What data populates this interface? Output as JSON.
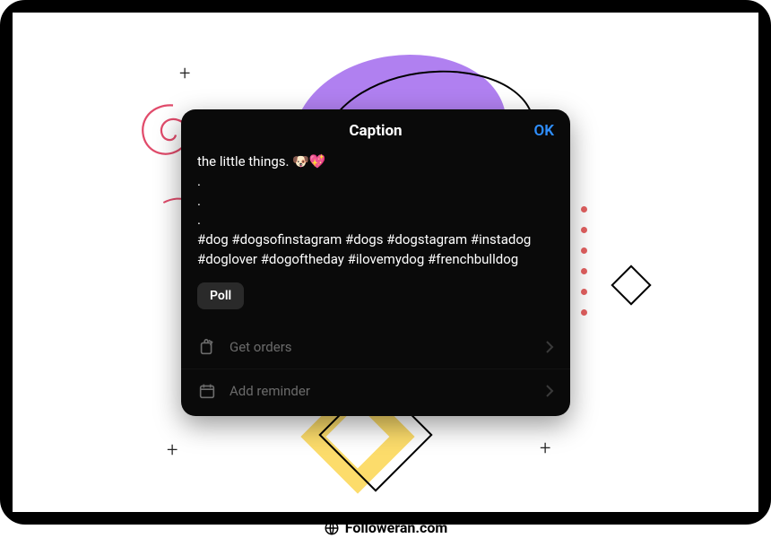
{
  "modal": {
    "title": "Caption",
    "ok_label": "OK",
    "caption_text": "the little things. 🐶💖\n.\n.\n.\n#dog #dogsofinstagram #dogs #dogstagram #instadog #doglover #dogoftheday #ilovemydog #frenchbulldog",
    "poll_label": "Poll",
    "rows": {
      "get_orders": "Get orders",
      "add_reminder": "Add reminder"
    }
  },
  "brand": "Followeran.com"
}
